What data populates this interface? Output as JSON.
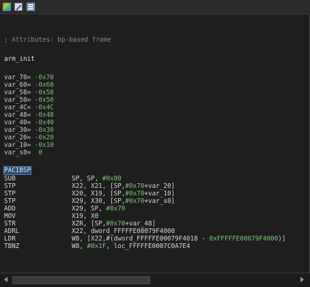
{
  "toolbar": {
    "icons": [
      "color-palette-icon",
      "edit-icon",
      "text-view-icon"
    ]
  },
  "disassembly": {
    "comment": "; Attributes: bp-based frame",
    "function_name": "arm_init",
    "stack_vars": [
      {
        "name": "var_70",
        "value": "-0x70"
      },
      {
        "name": "var_60",
        "value": "-0x60"
      },
      {
        "name": "var_58",
        "value": "-0x58"
      },
      {
        "name": "var_50",
        "value": "-0x50"
      },
      {
        "name": "var_4C",
        "value": "-0x4C"
      },
      {
        "name": "var_48",
        "value": "-0x48"
      },
      {
        "name": "var_40",
        "value": "-0x40"
      },
      {
        "name": "var_30",
        "value": "-0x30"
      },
      {
        "name": "var_20",
        "value": "-0x20"
      },
      {
        "name": "var_10",
        "value": "-0x10"
      },
      {
        "name": "var_s0",
        "value": "0"
      }
    ],
    "instructions": [
      {
        "mnemonic": "PACIBSP",
        "operands": ""
      },
      {
        "mnemonic": "SUB",
        "operands": "SP, SP, #0x80"
      },
      {
        "mnemonic": "STP",
        "operands": "X22, X21, [SP,#0x70+var_20]"
      },
      {
        "mnemonic": "STP",
        "operands": "X20, X19, [SP,#0x70+var_10]"
      },
      {
        "mnemonic": "STP",
        "operands": "X29, X30, [SP,#0x70+var_s0]"
      },
      {
        "mnemonic": "ADD",
        "operands": "X29, SP, #0x70"
      },
      {
        "mnemonic": "MOV",
        "operands": "X19, X0"
      },
      {
        "mnemonic": "STR",
        "operands": "XZR, [SP,#0x70+var_48]"
      },
      {
        "mnemonic": "ADRL",
        "operands": "X22, dword_FFFFFE00079F4000"
      },
      {
        "mnemonic": "LDR",
        "operands": "W8, [X22,#(dword_FFFFFE00079F4018 - 0xFFFFFE00079F4000)]"
      },
      {
        "mnemonic": "TBNZ",
        "operands": "W8, #0x1F, loc_FFFFFE0007C0A7E4"
      }
    ]
  },
  "colors": {
    "background": "#1e1e1e",
    "comment": "#8a8a8a",
    "numeric": "#7fc47f",
    "text": "#d8d8d8",
    "selection": "#264f78"
  }
}
